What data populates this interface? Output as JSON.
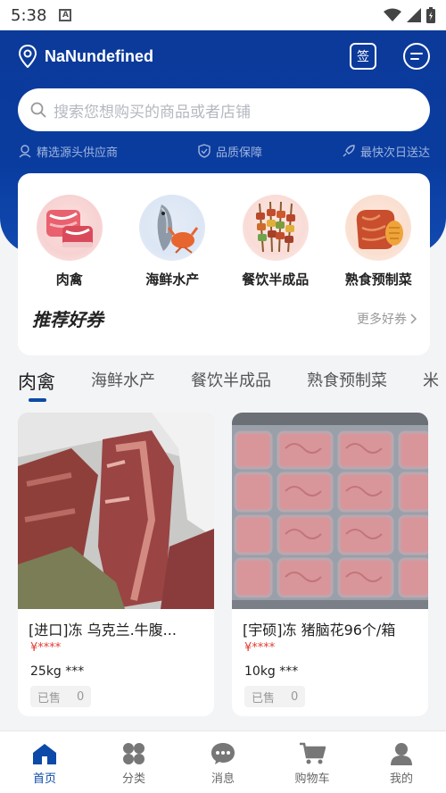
{
  "status_bar": {
    "time": "5:38",
    "notification_letter": "A"
  },
  "header": {
    "location_name": "NaNundefined",
    "checkin_label": "签",
    "search_placeholder": "搜索您想购买的商品或者店铺",
    "features": [
      "精选源头供应商",
      "品质保障",
      "最快次日送达"
    ]
  },
  "categories": [
    {
      "label": "肉禽",
      "icon": "meat-icon"
    },
    {
      "label": "海鲜水产",
      "icon": "seafood-icon"
    },
    {
      "label": "餐饮半成品",
      "icon": "skewer-icon"
    },
    {
      "label": "熟食预制菜",
      "icon": "prepared-food-icon"
    }
  ],
  "coupons": {
    "title": "推荐好券",
    "more_label": "更多好券"
  },
  "tabs": [
    {
      "label": "肉禽",
      "active": true
    },
    {
      "label": "海鲜水产",
      "active": false
    },
    {
      "label": "餐饮半成品",
      "active": false
    },
    {
      "label": "熟食预制菜",
      "active": false
    },
    {
      "label": "米",
      "active": false
    }
  ],
  "products": [
    {
      "name": "[进口]冻 乌克兰.牛腹...",
      "price": "¥****",
      "spec": "25kg ***",
      "sold_label": "已售",
      "sold_count": "0"
    },
    {
      "name": "[宇硕]冻 猪脑花96个/箱",
      "price": "¥****",
      "spec": "10kg ***",
      "sold_label": "已售",
      "sold_count": "0"
    }
  ],
  "nav": [
    {
      "label": "首页",
      "icon": "home-icon",
      "active": true
    },
    {
      "label": "分类",
      "icon": "category-icon",
      "active": false
    },
    {
      "label": "消息",
      "icon": "message-icon",
      "active": false
    },
    {
      "label": "购物车",
      "icon": "cart-icon",
      "active": false
    },
    {
      "label": "我的",
      "icon": "profile-icon",
      "active": false
    }
  ],
  "colors": {
    "brand_blue": "#0b3a9a",
    "price_red": "#e23b32",
    "active_nav": "#0b4aa8"
  }
}
